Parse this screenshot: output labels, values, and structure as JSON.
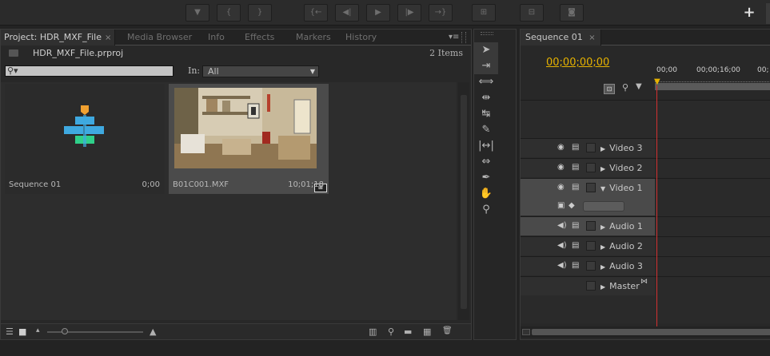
{
  "toolbar": {
    "buttons": [
      {
        "icon": "add-marker-icon",
        "glyph": "▼"
      },
      {
        "icon": "mark-in-icon",
        "glyph": "{"
      },
      {
        "icon": "mark-out-icon",
        "glyph": "}"
      },
      {
        "icon": "go-to-in-icon",
        "glyph": "{←"
      },
      {
        "icon": "step-back-icon",
        "glyph": "◀|"
      },
      {
        "icon": "play-icon",
        "glyph": "▶"
      },
      {
        "icon": "step-forward-icon",
        "glyph": "|▶"
      },
      {
        "icon": "go-to-out-icon",
        "glyph": "→}"
      },
      {
        "icon": "insert-icon",
        "glyph": "⊞"
      },
      {
        "icon": "overwrite-icon",
        "glyph": "⊟"
      },
      {
        "icon": "export-frame-icon",
        "glyph": "◙"
      }
    ],
    "plus": "+"
  },
  "project_panel": {
    "tabs": [
      {
        "label": "Project: HDR_MXF_File",
        "close": "×",
        "active": true
      },
      {
        "label": "Media Browser",
        "active": false
      },
      {
        "label": "Info",
        "active": false
      },
      {
        "label": "Effects",
        "active": false
      },
      {
        "label": "Markers",
        "active": false
      },
      {
        "label": "History",
        "active": false
      }
    ],
    "menu_glyph": "▾≡",
    "project_file": "HDR_MXF_File.prproj",
    "items_count": "2 Items",
    "search": {
      "icon_glyph": "⚲▾",
      "value": ""
    },
    "in_label": "In:",
    "in_select": {
      "value": "All",
      "arrow": "▼"
    },
    "items": [
      {
        "name": "Sequence 01",
        "duration": "0;00",
        "type": "sequence"
      },
      {
        "name": "B01C001.MXF",
        "duration": "10;01;18",
        "type": "clip",
        "badge": "⊞"
      }
    ],
    "bottom": {
      "list_view": "☰",
      "icon_view": "■",
      "zoom_small": "▴",
      "zoom_large": "▲",
      "zoom_level": 0.18,
      "automate": "▥",
      "find": "⚲",
      "new_bin": "▬",
      "new_item": "▦",
      "delete": "🗑"
    }
  },
  "tools": [
    {
      "name": "selection-tool",
      "glyph": "➤"
    },
    {
      "name": "track-select-tool",
      "glyph": "⇥"
    },
    {
      "name": "ripple-edit-tool",
      "glyph": "⟺"
    },
    {
      "name": "rolling-edit-tool",
      "glyph": "⇹"
    },
    {
      "name": "rate-stretch-tool",
      "glyph": "↹"
    },
    {
      "name": "razor-tool",
      "glyph": "✎"
    },
    {
      "name": "slip-tool",
      "glyph": "|↔|"
    },
    {
      "name": "slide-tool",
      "glyph": "⇔"
    },
    {
      "name": "pen-tool",
      "glyph": "✒"
    },
    {
      "name": "hand-tool",
      "glyph": "✋"
    },
    {
      "name": "zoom-tool",
      "glyph": "⚲"
    }
  ],
  "sequence_panel": {
    "tab_label": "Sequence 01",
    "tab_close": "×",
    "timecode": "00;00;00;00",
    "ruler_labels": [
      "00;00",
      "00;00;16;00",
      "00;"
    ],
    "snap_glyph": "⊡",
    "marker_glyph": "⚲",
    "flag_glyph": "▼",
    "playhead_glyph": "▼",
    "tracks": [
      {
        "name": "Video 3",
        "kind": "video",
        "expand": "▶",
        "selected": false
      },
      {
        "name": "Video 2",
        "kind": "video",
        "expand": "▶",
        "selected": false
      },
      {
        "name": "Video 1",
        "kind": "video",
        "expand": "▼",
        "selected": true
      },
      {
        "name": "Audio 1",
        "kind": "audio",
        "expand": "▶",
        "selected": true
      },
      {
        "name": "Audio 2",
        "kind": "audio",
        "expand": "▶",
        "selected": false
      },
      {
        "name": "Audio 3",
        "kind": "audio",
        "expand": "▶",
        "selected": false
      },
      {
        "name": "Master",
        "kind": "master",
        "expand": "▶",
        "selected": false
      }
    ],
    "master_glyph": "⋈"
  },
  "colors": {
    "accent_timecode": "#e6b200",
    "playhead": "#d23030",
    "panel_bg": "#282828",
    "seq_icon_orange": "#f0a030",
    "seq_icon_blue": "#3fa9e0",
    "seq_icon_green": "#2fd08a"
  }
}
